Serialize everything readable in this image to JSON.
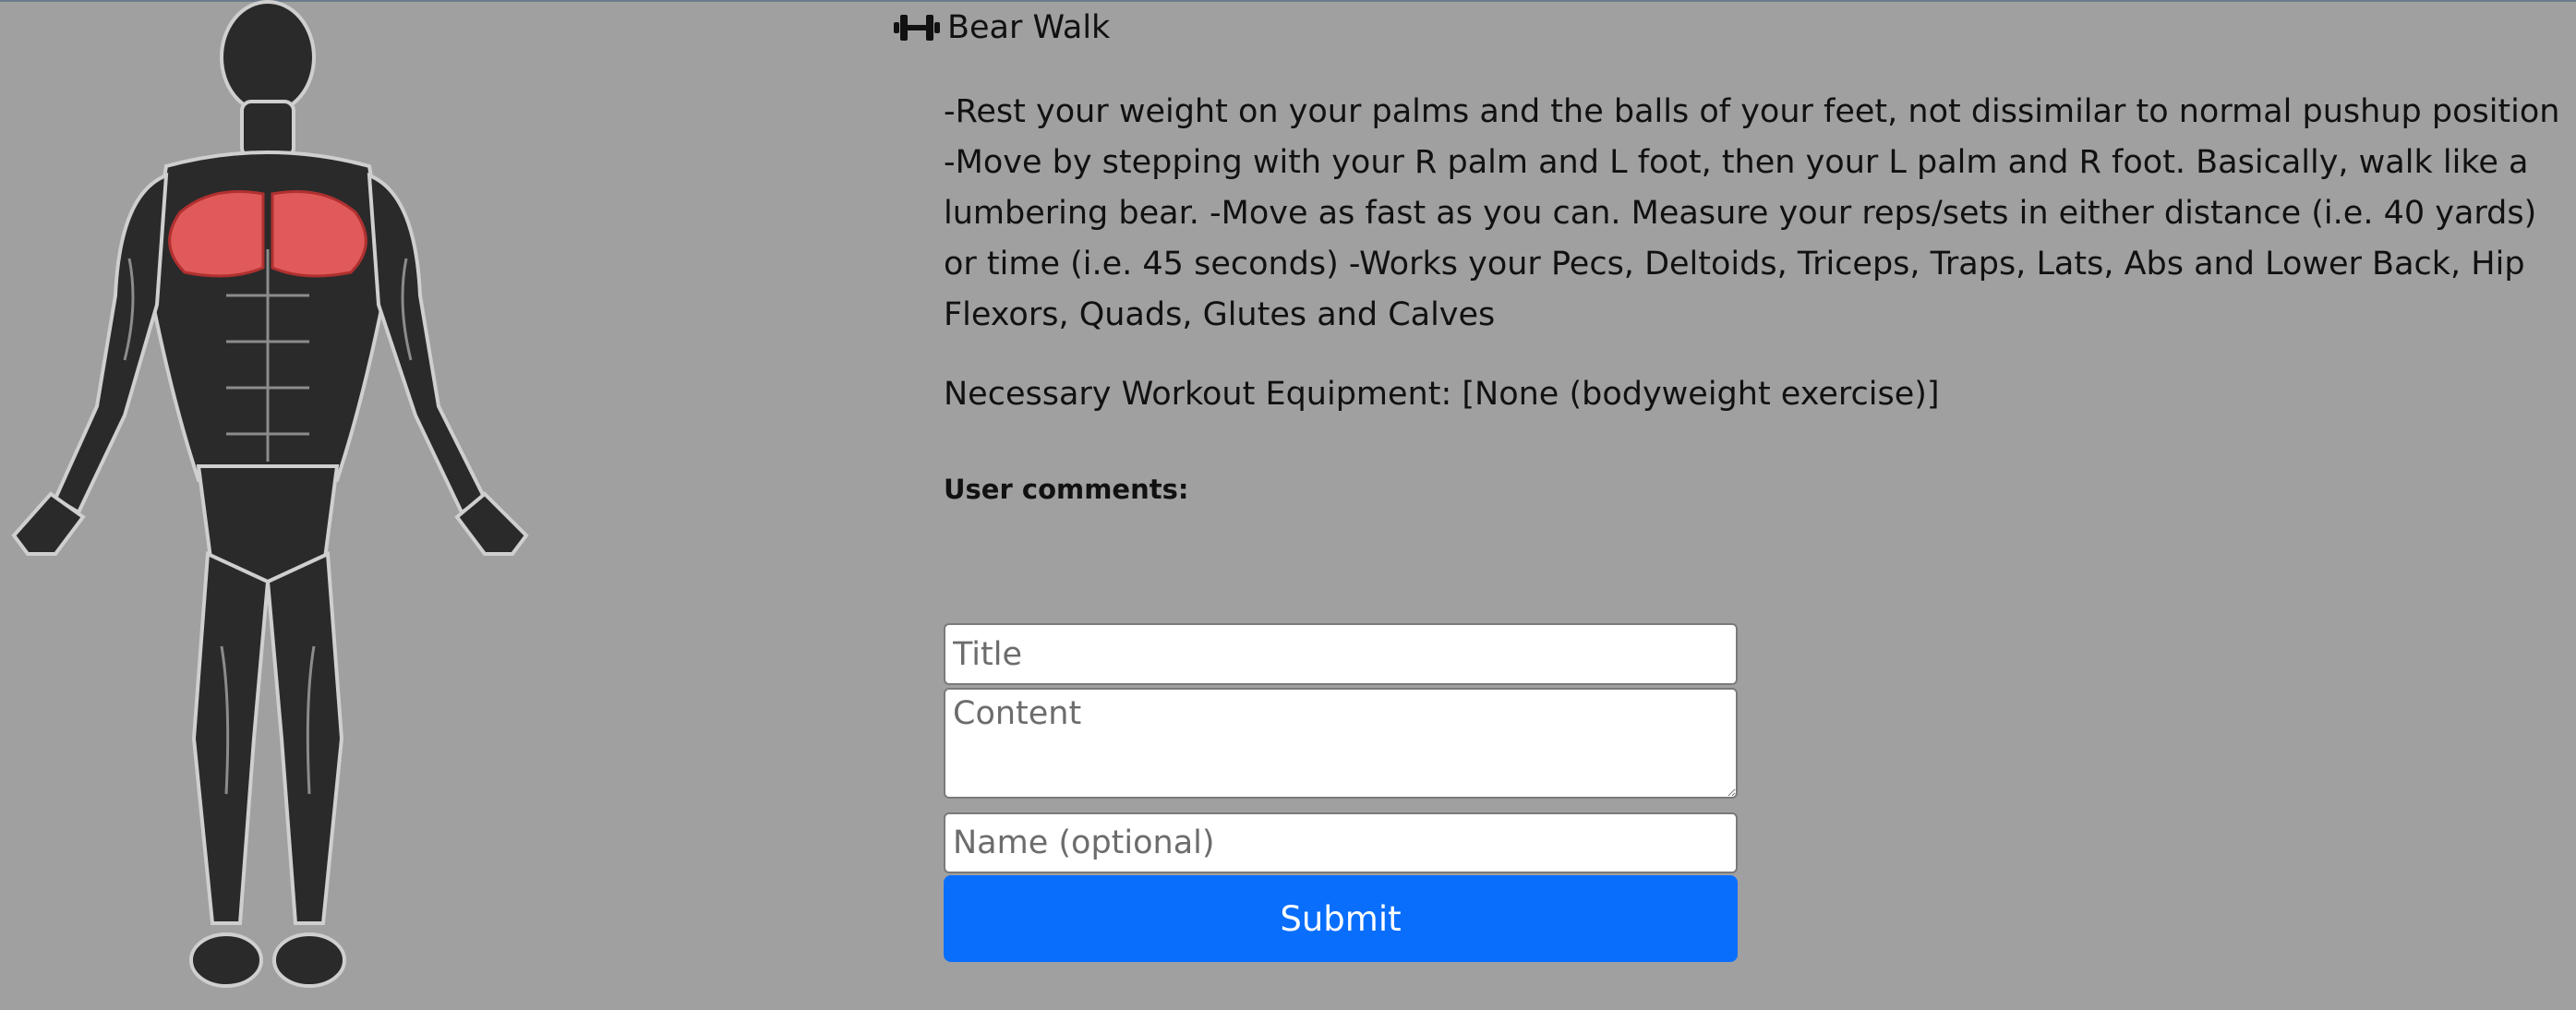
{
  "exercise": {
    "name": "Bear Walk",
    "icon": "dumbbell-icon",
    "description": [
      "-Rest your weight on your palms and the balls of your feet, not dissimilar to normal pushup position -Move by stepping with your R palm and L foot, then your L palm and R foot.  Basically, walk like a lumbering bear. -Move as fast as you can.  Measure your reps/sets in either distance (i.e. 40 yards) or time (i.e. 45 seconds) -Works your Pecs, Deltoids, Triceps, Traps, Lats, Abs and Lower Back, Hip Flexors, Quads, Glutes and Calves"
    ],
    "equipment": "Necessary Workout Equipment: [None (bodyweight exercise)]",
    "highlighted_muscle": "pectorals"
  },
  "comments": {
    "label": "User comments:"
  },
  "form": {
    "title_placeholder": "Title",
    "content_placeholder": "Content",
    "name_placeholder": "Name (optional)",
    "submit_label": "Submit"
  },
  "colors": {
    "background": "#a0a0a0",
    "highlight": "#e05a5a",
    "button": "#0a6efd"
  }
}
